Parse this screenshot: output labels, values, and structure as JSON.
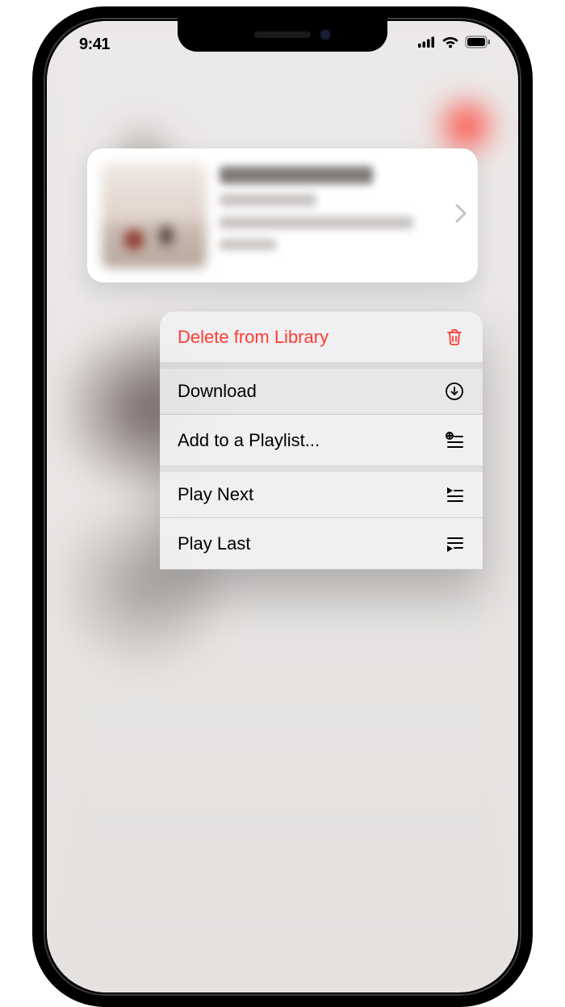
{
  "status": {
    "time": "9:41"
  },
  "menu": {
    "items": [
      {
        "label": "Delete from Library",
        "icon": "trash-icon",
        "destructive": true
      },
      {
        "label": "Download",
        "icon": "download-icon"
      },
      {
        "label": "Add to a Playlist...",
        "icon": "add-to-playlist-icon"
      },
      {
        "label": "Play Next",
        "icon": "play-next-icon"
      },
      {
        "label": "Play Last",
        "icon": "play-last-icon"
      }
    ]
  }
}
